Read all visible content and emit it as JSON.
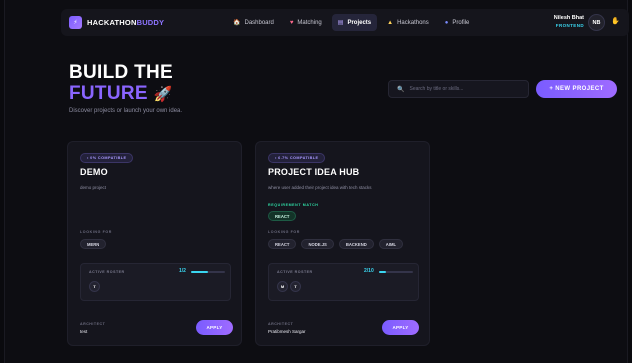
{
  "nav": {
    "logo_mark": "⚡",
    "logo_main": "HACKATHON",
    "logo_accent": "BUDDY",
    "links": [
      {
        "label": "Dashboard",
        "icon": "🏠",
        "icon_name": "home-icon"
      },
      {
        "label": "Matching",
        "icon": "♥",
        "icon_name": "heart-icon"
      },
      {
        "label": "Projects",
        "icon": "▤",
        "icon_name": "projects-icon"
      },
      {
        "label": "Hackathons",
        "icon": "▲",
        "icon_name": "trophy-icon"
      },
      {
        "label": "Profile",
        "icon": "●",
        "icon_name": "user-icon"
      }
    ],
    "active": "Projects",
    "user_name": "Nilesh Bhat",
    "user_role": "FRONTEND",
    "avatar_initials": "NB",
    "wave_icon": "✋"
  },
  "hero": {
    "line1": "BUILD THE",
    "line2": "FUTURE",
    "rocket": "🚀",
    "subtitle": "Discover projects or launch your own idea.",
    "search_placeholder": "Search by title or skills...",
    "new_project_label": "+ NEW PROJECT"
  },
  "projects": [
    {
      "compat": "• 0% COMPATIBLE",
      "title": "DEMO",
      "desc": "demo project",
      "looking_label": "LOOKING FOR",
      "looking": [
        "MERN"
      ],
      "roster_label": "ACTIVE ROSTER",
      "roster_count": "1/2",
      "roster_fill": 0.5,
      "members": [
        "T"
      ],
      "creator_label": "ARCHITECT",
      "creator": "test",
      "apply_label": "APPLY"
    },
    {
      "compat": "• 6.7% COMPATIBLE",
      "title": "PROJECT IDEA HUB",
      "desc": "where user added their project idea with tech stacks",
      "match_label": "REQUIREMENT MATCH",
      "matched": [
        "REACT"
      ],
      "looking_label": "LOOKING FOR",
      "looking": [
        "REACT",
        "NODE.JS",
        "BACKEND",
        "AIML"
      ],
      "roster_label": "ACTIVE ROSTER",
      "roster_count": "2/10",
      "roster_fill": 0.2,
      "members": [
        "M",
        "T"
      ],
      "creator_label": "ARCHITECT",
      "creator": "Pratibmesh Sargar",
      "apply_label": "APPLY"
    }
  ]
}
